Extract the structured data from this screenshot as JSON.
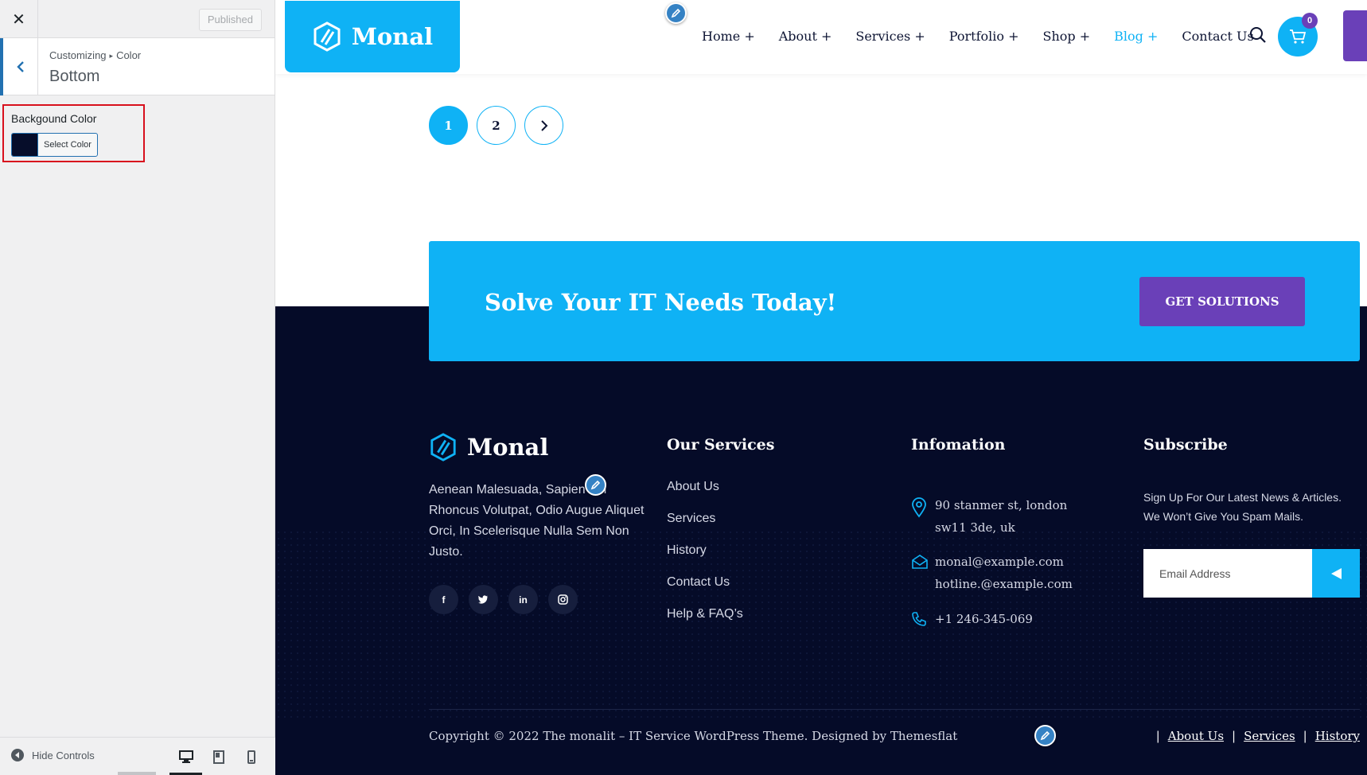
{
  "customizer": {
    "published_label": "Published",
    "breadcrumb": {
      "root": "Customizing",
      "separator": "▸",
      "section": "Color"
    },
    "section_title": "Bottom",
    "control": {
      "label": "Backgound Color",
      "button_label": "Select Color",
      "swatch_color": "#060d2a"
    },
    "hide_controls": "Hide Controls",
    "devices": [
      "desktop-icon",
      "tablet-icon",
      "mobile-icon"
    ]
  },
  "site": {
    "brand": "Monal",
    "accent_color": "#0fb2f5",
    "secondary_color": "#6a40b8",
    "nav": [
      {
        "label": "Home +",
        "active": false
      },
      {
        "label": "About +",
        "active": false
      },
      {
        "label": "Services +",
        "active": false
      },
      {
        "label": "Portfolio +",
        "active": false
      },
      {
        "label": "Shop +",
        "active": false
      },
      {
        "label": "Blog +",
        "active": true
      },
      {
        "label": "Contact Us",
        "active": false
      }
    ],
    "cart_count": "0",
    "pagination": [
      "1",
      "2"
    ],
    "cta": {
      "title": "Solve Your IT Needs Today!",
      "button": "GET SOLUTIONS"
    },
    "footer": {
      "description": "Aenean Malesuada, Sapien Vel Rhoncus Volutpat, Odio Augue Aliquet Orci, In Scelerisque Nulla Sem Non Justo.",
      "socials": [
        {
          "label": "f",
          "icon": "facebook-icon"
        },
        {
          "label": "t",
          "icon": "twitter-icon"
        },
        {
          "label": "in",
          "icon": "linkedin-icon"
        },
        {
          "label": "◎",
          "icon": "instagram-icon"
        }
      ],
      "services_title": "Our Services",
      "services": [
        "About Us",
        "Services",
        "History",
        "Contact Us",
        "Help & FAQ’s"
      ],
      "info_title": "Infomation",
      "address": [
        "90 stanmer st, london",
        "sw11 3de, uk"
      ],
      "emails": [
        "monal@example.com",
        "hotline.@example.com"
      ],
      "phone": "+1 246-345-069",
      "subscribe_title": "Subscribe",
      "subscribe_text": "Sign Up For Our Latest News & Articles. We Won’t Give You Spam Mails.",
      "email_placeholder": "Email Address",
      "copyright": "Copyright © 2022 The monalit – IT Service WordPress Theme. Designed by Themesflat",
      "bottom_links": [
        "About Us",
        "Services",
        "History"
      ],
      "link_separator": "|"
    }
  }
}
